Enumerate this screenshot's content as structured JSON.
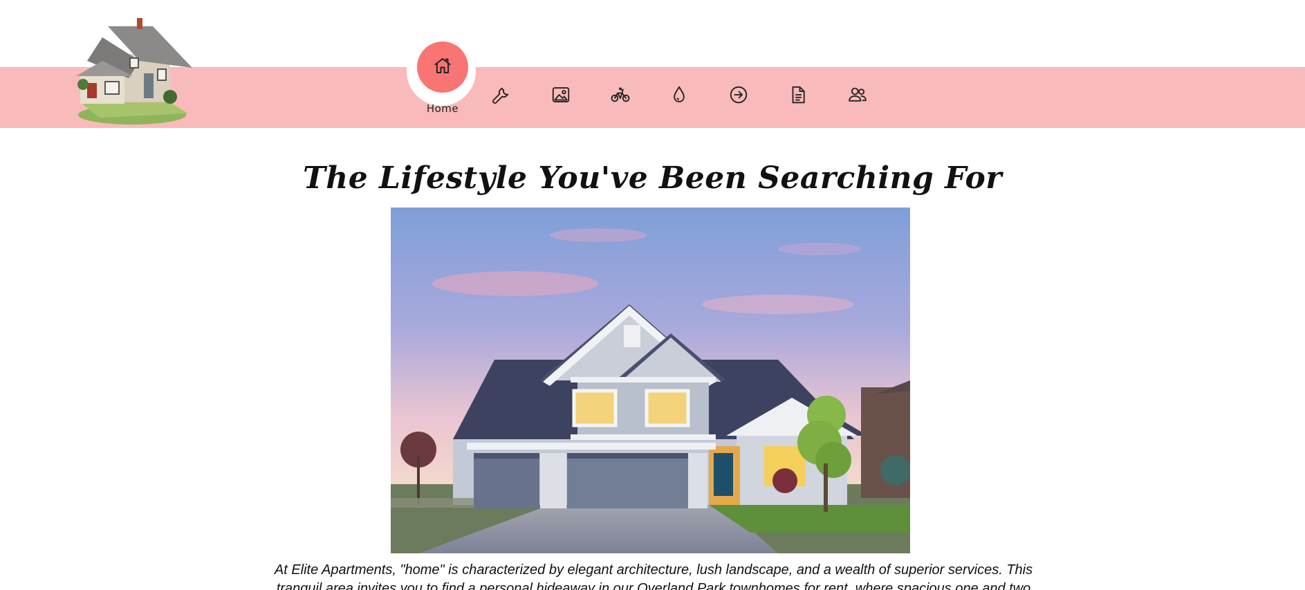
{
  "nav": {
    "home_label": "Home",
    "items": [
      {
        "icon": "home-icon",
        "label": "Home",
        "active": true
      },
      {
        "icon": "wrench-icon"
      },
      {
        "icon": "image-icon"
      },
      {
        "icon": "bicycle-icon"
      },
      {
        "icon": "water-drop-icon"
      },
      {
        "icon": "arrow-circle-right-icon"
      },
      {
        "icon": "document-icon"
      },
      {
        "icon": "users-icon"
      }
    ]
  },
  "colors": {
    "nav_band": "#f9babb",
    "active_circle": "#f87573"
  },
  "main": {
    "headline": "The Lifestyle You've Been Searching For",
    "intro": "At Elite Apartments, \"home\" is characterized by elegant architecture, lush landscape, and a wealth of superior services. This tranquil area invites you to find a personal hideaway in our Overland Park townhomes for rent, where spacious one and two"
  }
}
